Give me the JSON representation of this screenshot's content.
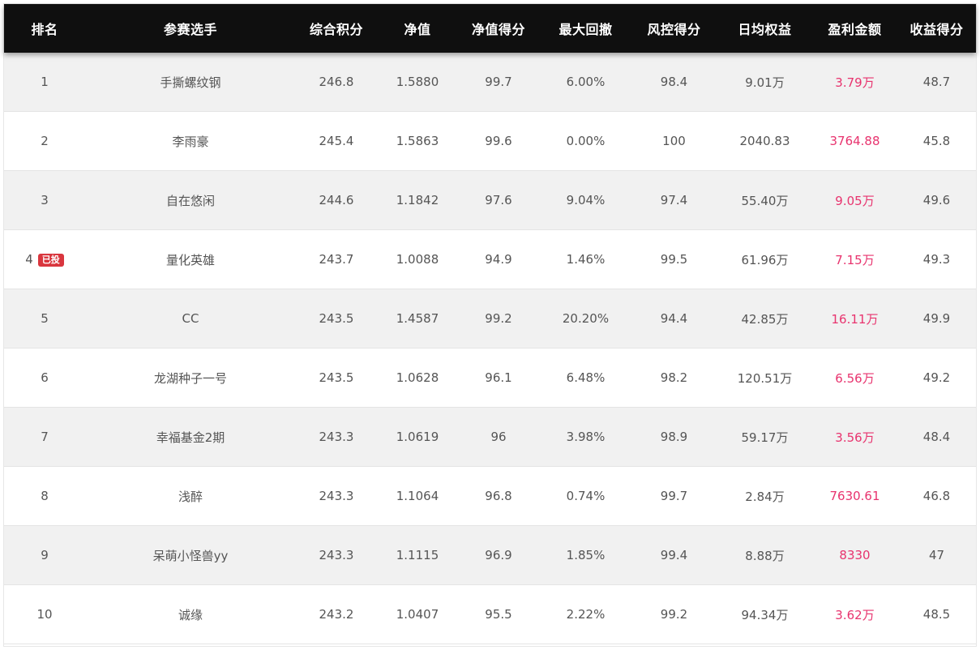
{
  "colors": {
    "header_bg": "#0f0f0f",
    "header_text": "#ffffff",
    "row_odd": "#f1f1f1",
    "row_even": "#ffffff",
    "text": "#555555",
    "profit": "#e8336e",
    "badge": "#d9363e"
  },
  "headers": [
    "排名",
    "参赛选手",
    "综合积分",
    "净值",
    "净值得分",
    "最大回撤",
    "风控得分",
    "日均权益",
    "盈利金额",
    "收益得分"
  ],
  "badge_label": "已投",
  "rows": [
    {
      "rank": "1",
      "name": "手撕螺纹钢",
      "score": "246.8",
      "nav": "1.5880",
      "nav_score": "99.7",
      "max_drawdown": "6.00%",
      "risk_score": "98.4",
      "avg_equity": "9.01万",
      "profit": "3.79万",
      "return_score": "48.7"
    },
    {
      "rank": "2",
      "name": "李雨豪",
      "score": "245.4",
      "nav": "1.5863",
      "nav_score": "99.6",
      "max_drawdown": "0.00%",
      "risk_score": "100",
      "avg_equity": "2040.83",
      "profit": "3764.88",
      "return_score": "45.8"
    },
    {
      "rank": "3",
      "name": "自在悠闲",
      "score": "244.6",
      "nav": "1.1842",
      "nav_score": "97.6",
      "max_drawdown": "9.04%",
      "risk_score": "97.4",
      "avg_equity": "55.40万",
      "profit": "9.05万",
      "return_score": "49.6"
    },
    {
      "rank": "4",
      "name": "量化英雄",
      "score": "243.7",
      "nav": "1.0088",
      "nav_score": "94.9",
      "max_drawdown": "1.46%",
      "risk_score": "99.5",
      "avg_equity": "61.96万",
      "profit": "7.15万",
      "return_score": "49.3",
      "badge": true
    },
    {
      "rank": "5",
      "name": "CC",
      "score": "243.5",
      "nav": "1.4587",
      "nav_score": "99.2",
      "max_drawdown": "20.20%",
      "risk_score": "94.4",
      "avg_equity": "42.85万",
      "profit": "16.11万",
      "return_score": "49.9"
    },
    {
      "rank": "6",
      "name": "龙湖种子一号",
      "score": "243.5",
      "nav": "1.0628",
      "nav_score": "96.1",
      "max_drawdown": "6.48%",
      "risk_score": "98.2",
      "avg_equity": "120.51万",
      "profit": "6.56万",
      "return_score": "49.2"
    },
    {
      "rank": "7",
      "name": "幸福基金2期",
      "score": "243.3",
      "nav": "1.0619",
      "nav_score": "96",
      "max_drawdown": "3.98%",
      "risk_score": "98.9",
      "avg_equity": "59.17万",
      "profit": "3.56万",
      "return_score": "48.4"
    },
    {
      "rank": "8",
      "name": "浅醉",
      "score": "243.3",
      "nav": "1.1064",
      "nav_score": "96.8",
      "max_drawdown": "0.74%",
      "risk_score": "99.7",
      "avg_equity": "2.84万",
      "profit": "7630.61",
      "return_score": "46.8"
    },
    {
      "rank": "9",
      "name": "呆萌小怪兽yy",
      "score": "243.3",
      "nav": "1.1115",
      "nav_score": "96.9",
      "max_drawdown": "1.85%",
      "risk_score": "99.4",
      "avg_equity": "8.88万",
      "profit": "8330",
      "return_score": "47"
    },
    {
      "rank": "10",
      "name": "诚缘",
      "score": "243.2",
      "nav": "1.0407",
      "nav_score": "95.5",
      "max_drawdown": "2.22%",
      "risk_score": "99.2",
      "avg_equity": "94.34万",
      "profit": "3.62万",
      "return_score": "48.5"
    }
  ]
}
